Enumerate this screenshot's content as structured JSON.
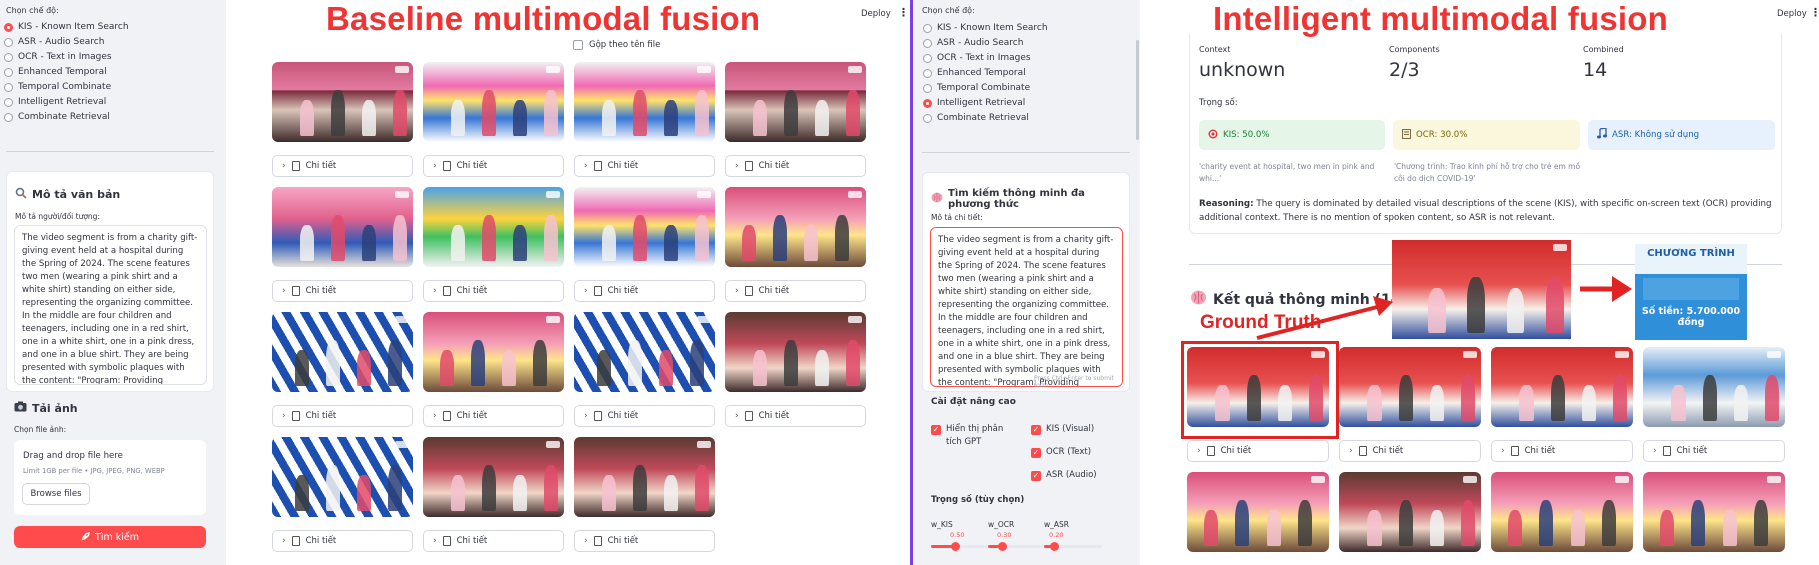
{
  "left": {
    "title": "Baseline multimodal fusion",
    "deploy": "Deploy",
    "sidebar": {
      "mode_label": "Chọn chế độ:",
      "modes": [
        "KIS - Known Item Search",
        "ASR - Audio Search",
        "OCR - Text in Images",
        "Enhanced Temporal",
        "Temporal Combinate",
        "Intelligent Retrieval",
        "Combinate Retrieval"
      ],
      "selected": 0,
      "text_section": {
        "title": "Mô tả văn bản",
        "field_label": "Mô tả người/đối tượng:",
        "value": "The video segment is from a charity gift-giving event held at a hospital during the Spring of 2024. The scene features two men (wearing a pink shirt and a white shirt) standing on either side, representing the organizing committee. In the middle are four children and teenagers, including one in a red shirt, one in a white shirt, one in a pink dress, and one in a blue shirt. They are being presented with symbolic plaques with the content: \"Program: Providing financial support for children orphaned by"
      },
      "image_section": {
        "title": "Tải ảnh",
        "field_label": "Chọn file ảnh:",
        "drop_title": "Drag and drop file here",
        "drop_hint": "Limit 1GB per file • JPG, JPEG, PNG, WEBP",
        "browse": "Browse files"
      },
      "search_button": "Tìm kiếm"
    },
    "group_checkbox": "Gộp theo tên file",
    "detail_label": "Chi tiết"
  },
  "right": {
    "title": "Intelligent multimodal fusion",
    "deploy": "Deploy",
    "sidebar": {
      "mode_label": "Chọn chế độ:",
      "modes": [
        "KIS - Known Item Search",
        "ASR - Audio Search",
        "OCR - Text in Images",
        "Enhanced Temporal",
        "Temporal Combinate",
        "Intelligent Retrieval",
        "Combinate Retrieval"
      ],
      "selected": 5,
      "search_section": {
        "title": "Tìm kiếm thông minh đa phương thức",
        "field_label": "Mô tả chi tiết:",
        "value": "The video segment is from a charity gift-giving event held at a hospital during the Spring of 2024. The scene features two men (wearing a pink shirt and a white shirt) standing on either side, representing the organizing committee. In the middle are four children and teenagers, including one in a red shirt, one in a white shirt, one in a pink dress, and one in a blue shirt. They are being presented with symbolic plaques with the content: \"Program: Providing financial support for children orphaned by",
        "hint": "Press Ctrl+Enter to submit form"
      },
      "advanced": {
        "title": "Cài đặt nâng cao",
        "show_gpt": "Hiển thị phân tích GPT",
        "kis": "KIS (Visual)",
        "ocr": "OCR (Text)",
        "asr": "ASR (Audio)"
      },
      "weights": {
        "title": "Trọng số (tùy chọn)",
        "items": [
          {
            "label": "w_KIS",
            "value": "0.50",
            "level": 0.5
          },
          {
            "label": "w_OCR",
            "value": "0.30",
            "level": 0.3
          },
          {
            "label": "w_ASR",
            "value": "0.20",
            "level": 0.2
          }
        ]
      }
    },
    "metrics": [
      {
        "label": "Context",
        "value": "unknown"
      },
      {
        "label": "Components",
        "value": "2/3"
      },
      {
        "label": "Combined",
        "value": "14"
      }
    ],
    "weights_label": "Trọng số:",
    "chips": [
      {
        "text": "KIS: 50.0%",
        "icon": "target-icon"
      },
      {
        "text": "OCR: 30.0%",
        "icon": "document-icon"
      },
      {
        "text": "ASR: Không sử dụng",
        "icon": "music-note-icon"
      }
    ],
    "chip_notes": [
      "'charity event at hospital, two men in pink and whi...'",
      "'Chương trình: Trao kinh phí hỗ trợ cho trẻ em mồ côi do dịch COVID-19'"
    ],
    "reasoning_label": "Reasoning:",
    "reasoning": "The query is dominated by detailed visual descriptions of the scene (KIS), with specific on-screen text (OCR) providing additional context. There is no mention of spoken content, so ASR is not relevant.",
    "results_title": "Kết quả thông minh (14)",
    "ground_truth": "Ground Truth",
    "plaque_text": {
      "heading": "CHƯƠNG TRÌNH",
      "amount": "Số tiền: 5.700.000 đồng"
    },
    "detail_label": "Chi tiết"
  },
  "colors": {
    "accent": "#ff4b4b",
    "annotation": "#e02424",
    "divider": "#7b3fe4",
    "sidebar": "#f0f2f6"
  }
}
